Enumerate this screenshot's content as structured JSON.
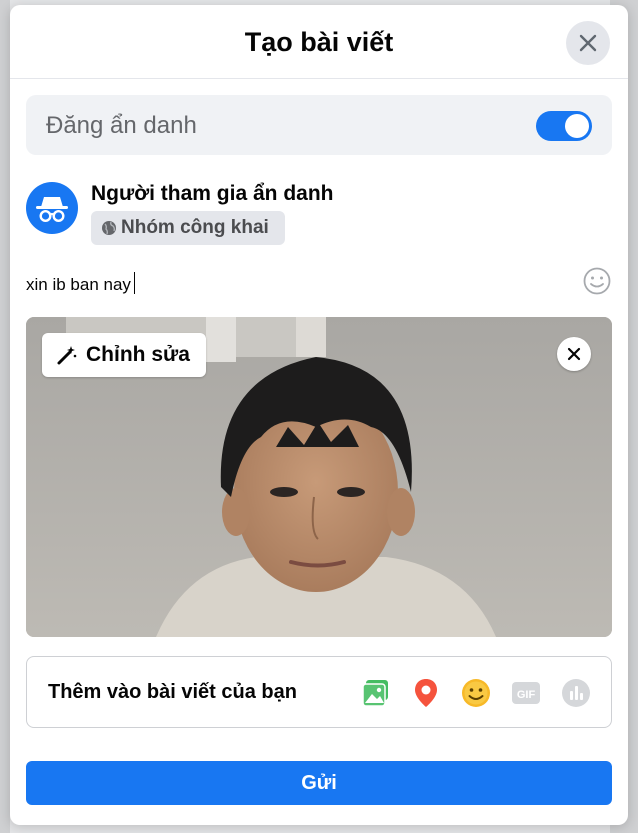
{
  "dialog": {
    "title": "Tạo bài viết"
  },
  "anonymous": {
    "label": "Đăng ẩn danh",
    "enabled": true
  },
  "author": {
    "name": "Người tham gia ẩn danh",
    "audience": "Nhóm công khai",
    "audience_icon": "globe-icon",
    "avatar_icon": "incognito-icon"
  },
  "composer": {
    "text": "xin ib ban nay"
  },
  "photo": {
    "edit_label": "Chỉnh sửa"
  },
  "add_to_post": {
    "label": "Thêm vào bài viết của bạn",
    "icons": [
      "photo-video-icon",
      "location-pin-icon",
      "feeling-emoji-icon",
      "gif-icon",
      "poll-icon"
    ]
  },
  "submit": {
    "label": "Gửi"
  },
  "colors": {
    "accent": "#1877f2",
    "muted": "#65676b",
    "pill_bg": "#f0f2f5"
  }
}
